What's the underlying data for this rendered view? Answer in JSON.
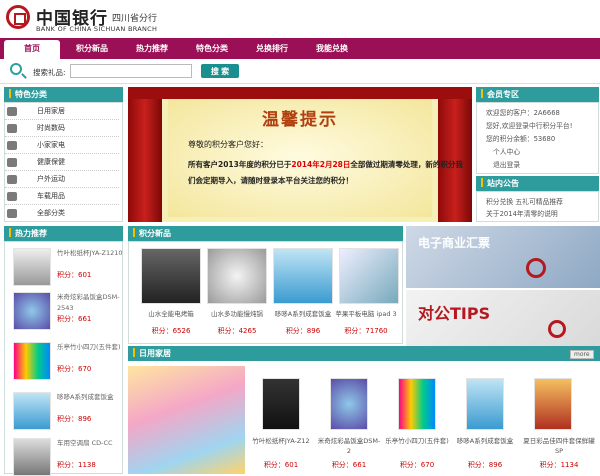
{
  "header": {
    "logo_cn": "中国银行",
    "branch": "四川省分行",
    "logo_en": "BANK OF CHINA   SICHUAN BRANCH"
  },
  "nav": [
    "首页",
    "积分新品",
    "热力推荐",
    "特色分类",
    "兑换排行",
    "我能兑换"
  ],
  "search": {
    "label": "搜索礼品:",
    "value": "",
    "button": "搜 索"
  },
  "categories": {
    "title": "特色分类",
    "items": [
      "日用家居",
      "时尚数码",
      "小家家电",
      "健康保健",
      "户外运动",
      "车载用品",
      "全部分类"
    ]
  },
  "banner": {
    "title": "温馨提示",
    "greeting": "尊敬的积分客户您好：",
    "body_1": "所有客户2013年度的积分已于",
    "date": "2014年2月28日",
    "body_2": "全部做过期清零处理，新的积分我们会定期导入，请随时登录本平台关注您的积分！"
  },
  "members": {
    "title": "会员专区",
    "lines": [
      "欢迎您的客户：2A6668",
      "您好,欢迎登录中行积分平台!",
      "您的积分余额：53680",
      "个人中心",
      "退出登录"
    ]
  },
  "notice": {
    "title": "站内公告",
    "items": [
      "积分兑换 五礼可精品推荐",
      "关于2014年清零的说明"
    ]
  },
  "hot": {
    "title": "热力推荐",
    "items": [
      {
        "name": "竹叶松纸杯JYA-Z1210",
        "price": "积分：601"
      },
      {
        "name": "米奇炫彩晶饭盒DSM-2543",
        "price": "积分：661"
      },
      {
        "name": "乐亭竹小四刀(五件套)",
        "price": "积分：670"
      },
      {
        "name": "哆哆A系列成套饭盒",
        "price": "积分：896"
      },
      {
        "name": "车用空调扇 CD-CC",
        "price": "积分：1138"
      }
    ]
  },
  "points_new": {
    "title": "积分新品",
    "items": [
      {
        "name": "山水全能电烤箱",
        "price": "积分：6526"
      },
      {
        "name": "山水多功能慢炖锅",
        "price": "积分：4265"
      },
      {
        "name": "哆哆A系列成套饭盒",
        "price": "积分：896"
      },
      {
        "name": "苹果平板电脑 ipad 3",
        "price": "积分：71760"
      }
    ]
  },
  "ads": {
    "ad1_text": "电子商业汇票",
    "ad2_text": "对公TIPS",
    "more": "more"
  },
  "daily": {
    "title": "日用家居",
    "items": [
      {
        "name": "竹叶松纸杯JYA-Z12",
        "price": "积分：601"
      },
      {
        "name": "米奇炫彩晶饭盒DSM-2",
        "price": "积分：661"
      },
      {
        "name": "乐亭竹小四刀(五件套)",
        "price": "积分：670"
      },
      {
        "name": "哆哆A系列成套饭盒",
        "price": "积分：896"
      },
      {
        "name": "夏日彩品佳四件套保鲜罐SP",
        "price": "积分：1134"
      }
    ]
  },
  "colors": {
    "nav": "#9b0f56",
    "teal": "#2e9c9c",
    "price": "#cc0000"
  }
}
